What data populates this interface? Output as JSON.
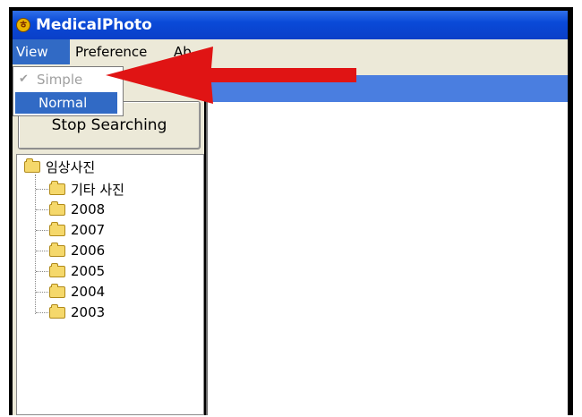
{
  "window": {
    "title": "MedicalPhoto",
    "icon": "app-logo-icon"
  },
  "menubar": {
    "items": [
      {
        "label": "View"
      },
      {
        "label": "Preference"
      },
      {
        "label": "Ab"
      }
    ]
  },
  "view_menu": {
    "items": [
      {
        "label": "Simple",
        "checked": true,
        "disabled": true
      },
      {
        "label": "Normal",
        "highlighted": true
      }
    ]
  },
  "left_panel": {
    "stop_button": "Stop Searching",
    "tree": {
      "root": "임상사진",
      "children": [
        "기타 사진",
        "2008",
        "2007",
        "2006",
        "2005",
        "2004",
        "2003"
      ]
    }
  },
  "colors": {
    "accent": "#316ac5",
    "annotation_arrow": "#e01414",
    "titlebar": "#0a4ad8"
  }
}
